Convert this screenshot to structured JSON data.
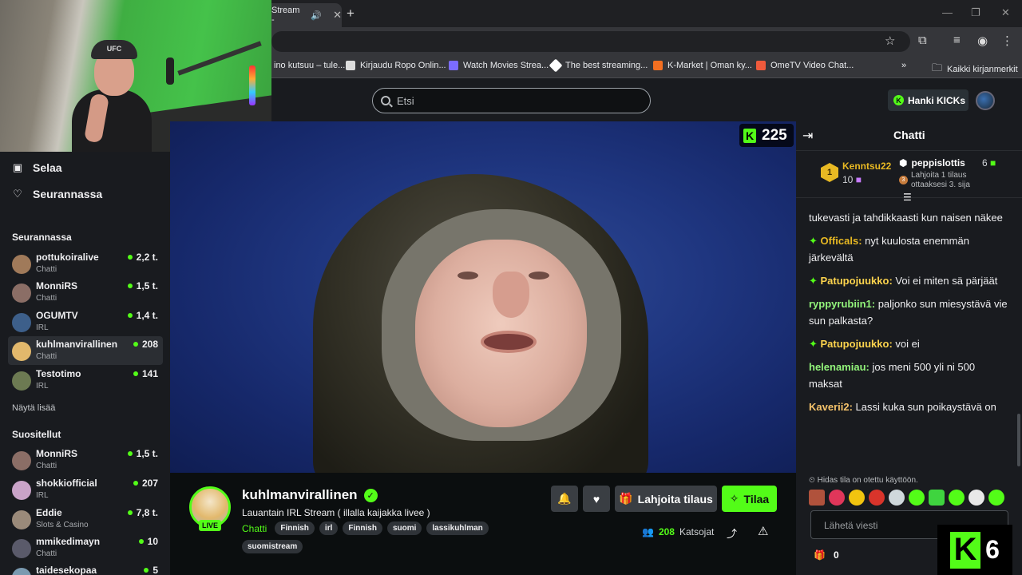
{
  "browser": {
    "tab_title": "Stream -",
    "win_min": "—",
    "win_max": "❐",
    "win_close": "✕",
    "bookmarks": [
      {
        "label": "ino kutsuu – tule...",
        "color": "#35363a"
      },
      {
        "label": "Kirjaudu Ropo Onlin...",
        "color": "#ffffff"
      },
      {
        "label": "Watch Movies Strea...",
        "color": "#7b6cff"
      },
      {
        "label": "The best streaming...",
        "color": "#ffffff"
      },
      {
        "label": "K-Market | Oman ky...",
        "color": "#f36f21"
      },
      {
        "label": "OmeTV Video Chat...",
        "color": "#ef5a3c"
      }
    ],
    "all_bookmarks": "Kaikki kirjanmerkit"
  },
  "topbar": {
    "search_placeholder": "Etsi",
    "kicks_label": "Hanki KICKs"
  },
  "webcam": {
    "cap_text": "UFC"
  },
  "sidebar": {
    "nav": [
      {
        "label": "Selaa"
      },
      {
        "label": "Seurannassa"
      }
    ],
    "following_title": "Seurannassa",
    "following": [
      {
        "name": "pottukoiralive",
        "category": "Chatti",
        "viewers": "2,2 t.",
        "avatar": "#a07a5a"
      },
      {
        "name": "MonniRS",
        "category": "Chatti",
        "viewers": "1,5 t.",
        "avatar": "#8b6e66"
      },
      {
        "name": "OGUMTV",
        "category": "IRL",
        "viewers": "1,4 t.",
        "avatar": "#3d5f8a"
      },
      {
        "name": "kuhlmanvirallinen",
        "category": "Chatti",
        "viewers": "208",
        "avatar": "#e2b86c"
      },
      {
        "name": "Testotimo",
        "category": "IRL",
        "viewers": "141",
        "avatar": "#6c7a52"
      }
    ],
    "show_more": "Näytä lisää",
    "recommended_title": "Suositellut",
    "recommended": [
      {
        "name": "MonniRS",
        "category": "Chatti",
        "viewers": "1,5 t.",
        "avatar": "#8b6e66"
      },
      {
        "name": "shokkiofficial",
        "category": "IRL",
        "viewers": "207",
        "avatar": "#c9a3c8"
      },
      {
        "name": "Eddie",
        "category": "Slots & Casino",
        "viewers": "7,8 t.",
        "avatar": "#9a8a7a"
      },
      {
        "name": "mmikedimayn",
        "category": "Chatti",
        "viewers": "10",
        "avatar": "#5a5a6a"
      },
      {
        "name": "taidesekopaa",
        "category": "",
        "viewers": "5",
        "avatar": "#7a9ab0"
      }
    ]
  },
  "video": {
    "viewer_count": "225"
  },
  "stream": {
    "name": "kuhlmanvirallinen",
    "title": "Lauantain IRL Stream ( illalla kaijakka livee )",
    "category": "Chatti",
    "tags": [
      "Finnish",
      "irl",
      "Finnish",
      "suomi",
      "lassikuhlman",
      "suomistream"
    ],
    "live": "LIVE",
    "gift_label": "Lahjoita tilaus",
    "subscribe_label": "Tilaa",
    "watchers": "208",
    "watchers_label": "Katsojat"
  },
  "chat": {
    "title": "Chatti",
    "leaderboard": {
      "first": {
        "rank": "1",
        "name": "Kenntsu22",
        "value": "10"
      },
      "second": {
        "name": "peppislottis",
        "value": "6",
        "sub": "Lahjoita 1 tilaus ottaaksesi 3. sija"
      }
    },
    "messages": [
      {
        "user": "",
        "text": "tukevasti ja tahdikkaasti kun naisen näkee",
        "color": "#efeff1"
      },
      {
        "user": "Officals:",
        "text": "nyt kuulosta enemmän järkevältä",
        "color": "#e8b923",
        "badge": true
      },
      {
        "user": "Patupojuukko:",
        "text": "Voi ei miten sä pärjäät",
        "color": "#fcd34d",
        "badge": true
      },
      {
        "user": "ryppyrubiin1:",
        "text": "paljonko sun miesystävä vie sun palkasta?",
        "color": "#93f57b",
        "badge": false
      },
      {
        "user": "Patupojuukko:",
        "text": "voi ei",
        "color": "#fcd34d",
        "badge": true
      },
      {
        "user": "helenamiau:",
        "text": "jos meni 500 yli ni 500 maksat",
        "color": "#93f57b",
        "badge": false
      },
      {
        "user": "Kaverii2:",
        "text": "Lassi kuka sun poikaystävä on",
        "color": "#f5c36b",
        "badge": false
      }
    ],
    "slow_mode": "Hidas tila on otettu käyttöön.",
    "input_placeholder": "Lähetä viesti",
    "kicks_count": "0",
    "big_k_number": "6"
  },
  "colors": {
    "accent": "#53fc18",
    "background": "#0b0e0f",
    "panel": "#191b1f"
  }
}
